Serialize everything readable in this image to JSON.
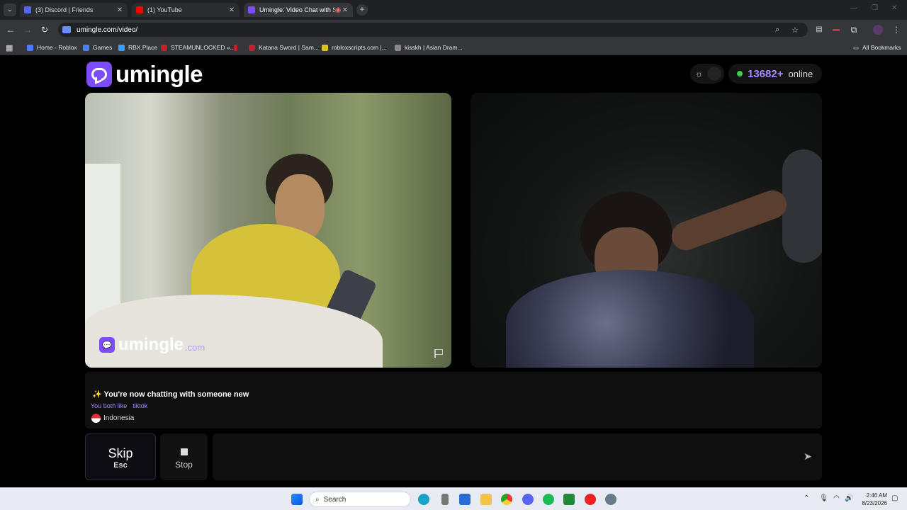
{
  "browser": {
    "tabs": [
      {
        "title": "(3) Discord | Friends",
        "favicon_color": "#5865f2",
        "active": false
      },
      {
        "title": "(1) YouTube",
        "favicon_color": "#ff0000",
        "active": false
      },
      {
        "title": "Umingle: Video Chat with S",
        "favicon_color": "#7c4dff",
        "active": true
      }
    ],
    "url": "umingle.com/video/",
    "bookmarks": [
      {
        "label": "Home - Roblox",
        "color": "#4a7cff"
      },
      {
        "label": "Games",
        "color": "#4a7cff"
      },
      {
        "label": "RBX.Place",
        "color": "#3b9cff"
      },
      {
        "label": "STEAMUNLOCKED »...",
        "color": "#c0202a"
      },
      {
        "label": "",
        "color": "#c0202a"
      },
      {
        "label": "Katana Sword | Sam...",
        "color": "#c0202a"
      },
      {
        "label": "robloxscripts.com |...",
        "color": "#e0c020"
      },
      {
        "label": "kisskh | Asian Dram...",
        "color": "#888888"
      }
    ],
    "all_bookmarks": "All Bookmarks"
  },
  "site": {
    "logo_text": "umingle",
    "online_count": "13682+",
    "online_label": "online",
    "watermark_text": "umingle",
    "watermark_suffix": ".com",
    "accent": "#7c4dff"
  },
  "info": {
    "title": "✨ You're now chatting with someone new",
    "likes_prefix": "You both like",
    "likes_tag": "tiktok",
    "country": "Indonesia"
  },
  "controls": {
    "skip_label": "Skip",
    "skip_hint": "Esc",
    "stop_label": "Stop",
    "message_placeholder": ""
  },
  "taskbar": {
    "search_label": "Search",
    "time": "2:46 AM",
    "date": "8/23/2026"
  }
}
